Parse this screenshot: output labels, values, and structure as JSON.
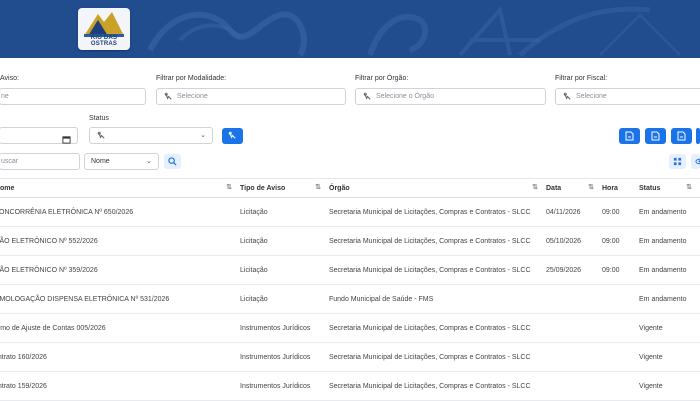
{
  "header": {
    "logo_text": "RIO DAS OSTRAS",
    "accent_color": "#214d8f"
  },
  "filters": {
    "tipo_label": "Aviso:",
    "tipo_placeholder": "ne",
    "modalidade_label": "Filtrar por Modalidade:",
    "modalidade_placeholder": "Selecione",
    "orgao_label": "Filtrar por Órgão:",
    "orgao_placeholder": "Selecione o Órgão",
    "fiscal_label": "Filtrar por Fiscal:",
    "fiscal_placeholder": "Selecione",
    "status_label": "Status"
  },
  "search": {
    "placeholder": "uscar",
    "field_select": "Nome"
  },
  "table": {
    "columns": [
      "ome",
      "Tipo de Aviso",
      "Órgão",
      "Data",
      "Hora",
      "Status"
    ],
    "rows": [
      [
        "CONCORRÊNIA ELETRÔNICA Nº 650/2026",
        "Licitação",
        "Secretaria Municipal de Licitações, Compras e Contratos - SLCC",
        "04/11/2026",
        "09:00",
        "Em andamento"
      ],
      [
        "GÃO ELETRÔNICO Nº 552/2026",
        "Licitação",
        "Secretaria Municipal de Licitações, Compras e Contratos - SLCC",
        "05/10/2026",
        "09:00",
        "Em andamento"
      ],
      [
        "GÃO ELETRÔNICO Nº 359/2026",
        "Licitação",
        "Secretaria Municipal de Licitações, Compras e Contratos - SLCC",
        "25/09/2026",
        "09:00",
        "Em andamento"
      ],
      [
        "OMOLOGAÇÃO DISPENSA ELETRÔNICA Nº 531/2026",
        "Licitação",
        "Fundo Municipal de Saúde - FMS",
        "",
        "",
        "Em andamento"
      ],
      [
        "ermo de Ajuste de Contas 005/2026",
        "Instrumentos Jurídicos",
        "Secretaria Municipal de Licitações, Compras e Contratos - SLCC",
        "",
        "",
        "Vigente"
      ],
      [
        "ontrato 160/2026",
        "Instrumentos Jurídicos",
        "Secretaria Municipal de Licitações, Compras e Contratos - SLCC",
        "",
        "",
        "Vigente"
      ],
      [
        "ontrato 159/2026",
        "Instrumentos Jurídicos",
        "Secretaria Municipal de Licitações, Compras e Contratos - SLCC",
        "",
        "",
        "Vigente"
      ]
    ]
  },
  "icons": {
    "filter": "filter-icon",
    "calendar": "calendar-icon",
    "export": "document-export-icon",
    "search": "search-icon",
    "grid": "grid-view-icon",
    "eye": "eye-icon",
    "sort": "sort-icon"
  }
}
